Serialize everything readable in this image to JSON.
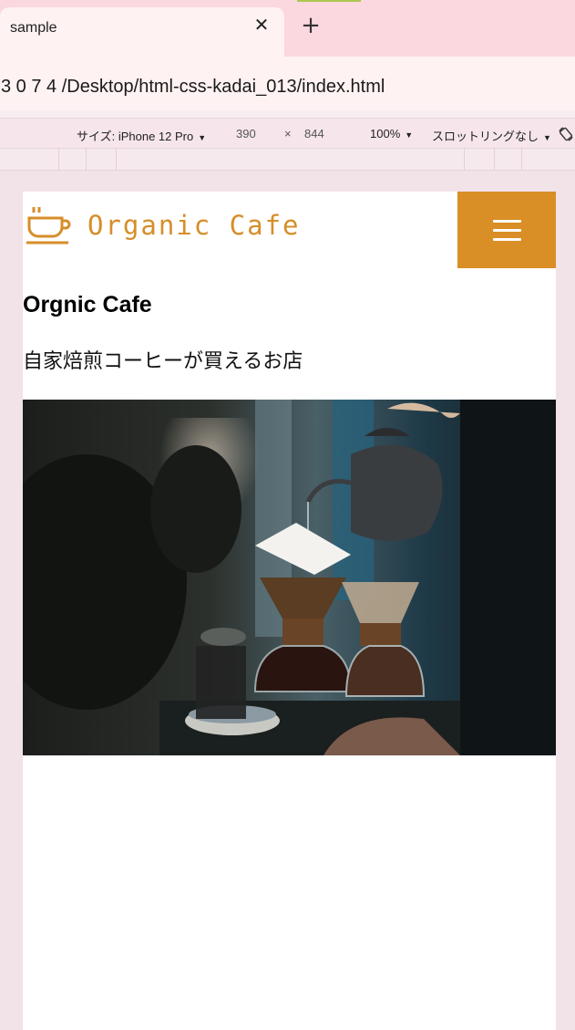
{
  "browser": {
    "tab_title": "sample",
    "tab_close_icon": "close-icon",
    "new_tab_icon": "plus-icon",
    "url": "3 0 7 4 /Desktop/html-css-kadai_013/index.html"
  },
  "device_toolbar": {
    "device_label": "サイズ: iPhone 12 Pro",
    "width": "390",
    "times": "×",
    "height": "844",
    "zoom": "100%",
    "throttle": "スロットリングなし",
    "rotate_icon": "rotate-icon"
  },
  "site": {
    "logo_icon": "coffee-cup-icon",
    "logo_text": "Organic Cafe",
    "menu_icon": "hamburger-menu-icon",
    "heading": "Orgnic Cafe",
    "subtitle": "自家焙煎コーヒーが買えるお店",
    "hero_image": "coffee-pour-over-photo"
  },
  "colors": {
    "accent": "#d98e26",
    "tab_strip": "#fbd7df",
    "page_bg": "#f1e3e8"
  }
}
